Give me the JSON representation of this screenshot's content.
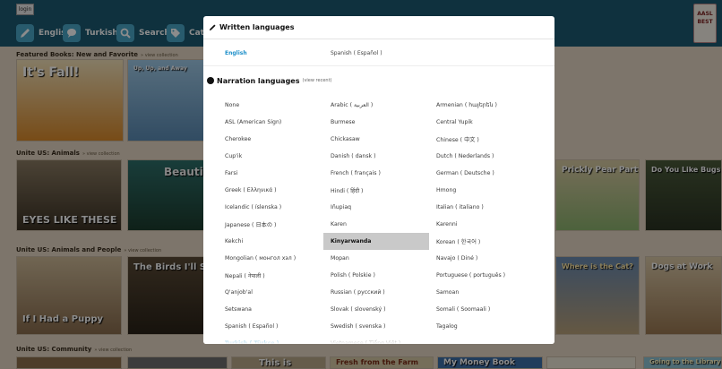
{
  "topbar": {
    "login_label": "login",
    "nav": [
      {
        "label": "English",
        "icon": "pencil-icon"
      },
      {
        "label": "Turkish",
        "icon": "speech-bubble-icon"
      },
      {
        "label": "Search",
        "icon": "search-icon"
      },
      {
        "label": "Cat",
        "icon": "tag-icon"
      }
    ],
    "badge_text": "AASL BEST"
  },
  "sections": [
    {
      "title": "Featured Books: New and Favorite",
      "link": "» view collection"
    },
    {
      "title": "Unite US: Animals",
      "link": "» view collection"
    },
    {
      "title": "Unite US: Animals and People",
      "link": "» view collection"
    },
    {
      "title": "Unite US: Community",
      "link": "» view collection"
    }
  ],
  "books": {
    "its_fall": "It's Fall!",
    "fly_high": "Up, Up, and Away",
    "eyes": "EYES LIKE THESE",
    "beaut": "Beautiful Bi",
    "prickly": "Prickly Pear Party",
    "bugs": "Do You Like Bugs?",
    "birds": "The Birds I'll S",
    "if_i": "If I Had a Puppy",
    "cats": "Where is the Cat?",
    "dogs": "Dogs at Work",
    "this_is": "This is",
    "fresh": "Fresh from the Farm",
    "money": "My Money Book",
    "going": "Going to the Library"
  },
  "modal": {
    "written_title": "Written languages",
    "written": [
      {
        "label": "English",
        "active": true
      },
      {
        "label": "Spanish ( Español )",
        "active": false
      }
    ],
    "narration_title": "Narration languages",
    "narration_hint": "(view recent)",
    "languages": [
      "None",
      "Arabic ( العربية )",
      "Armenian ( hայերեն )",
      "ASL (American Sign)",
      "Burmese",
      "Central Yupik",
      "Cherokee",
      "Chickasaw",
      "Chinese ( 中文 )",
      "Cup'ik",
      "Danish ( dansk )",
      "Dutch ( Nederlands )",
      "Farsi",
      "French ( français )",
      "German ( Deutsche )",
      "Greek ( Ελληνικά )",
      "Hindi ( हिंदी )",
      "Hmong",
      "Icelandic ( íslenska )",
      "Iñupiaq",
      "Italian ( italiano )",
      "Japanese ( 日本の )",
      "Karen",
      "Karenni",
      "Kekchi",
      "Kinyarwanda",
      "Korean ( 한국어 )",
      "Mongolian ( монгол хэл )",
      "Mopan",
      "Navajo ( Diné )",
      "Nepali ( नेपाली )",
      "Polish ( Polskie )",
      "Portuguese ( português )",
      "Q'anjob'al",
      "Russian ( русский )",
      "Samoan",
      "Setswana",
      "Slovak ( slovenský )",
      "Somali ( Soomaali )",
      "Spanish ( Español )",
      "Swedish ( svenska )",
      "Tagalog",
      "Turkish ( Türkçe )",
      "Vietnamese ( Tiếng Việt )",
      ""
    ],
    "selected_language": "Kinyarwanda",
    "active_language": "Turkish ( Türkçe )"
  }
}
